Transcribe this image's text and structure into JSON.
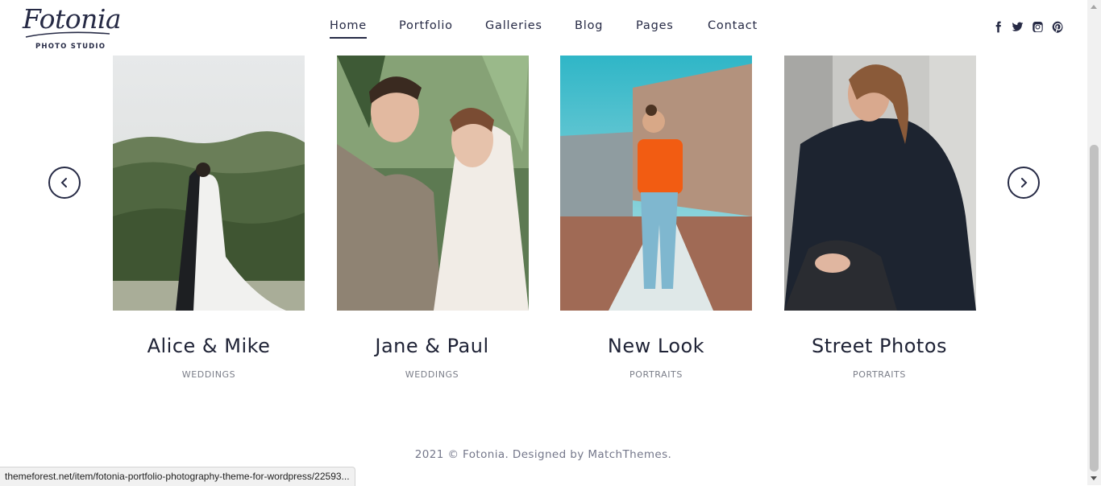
{
  "brand": {
    "name": "Fotonia",
    "tagline": "PHOTO STUDIO"
  },
  "nav": {
    "items": [
      {
        "label": "Home",
        "active": true
      },
      {
        "label": "Portfolio",
        "active": false
      },
      {
        "label": "Galleries",
        "active": false
      },
      {
        "label": "Blog",
        "active": false
      },
      {
        "label": "Pages",
        "active": false
      },
      {
        "label": "Contact",
        "active": false
      }
    ]
  },
  "social": [
    "facebook-icon",
    "twitter-icon",
    "instagram-icon",
    "pinterest-icon"
  ],
  "gallery": {
    "cards": [
      {
        "title": "Alice & Mike",
        "category": "WEDDINGS"
      },
      {
        "title": "Jane & Paul",
        "category": "WEDDINGS"
      },
      {
        "title": "New Look",
        "category": "PORTRAITS"
      },
      {
        "title": "Street Photos",
        "category": "PORTRAITS"
      }
    ],
    "prev_icon": "chevron-left-icon",
    "next_icon": "chevron-right-icon"
  },
  "footer": {
    "text": "2021 © Fotonia. Designed by MatchThemes."
  },
  "status_bar": {
    "url": "themeforest.net/item/fotonia-portfolio-photography-theme-for-wordpress/22593..."
  },
  "colors": {
    "primary": "#262a45",
    "muted": "#7a7d88",
    "background": "#ffffff"
  }
}
